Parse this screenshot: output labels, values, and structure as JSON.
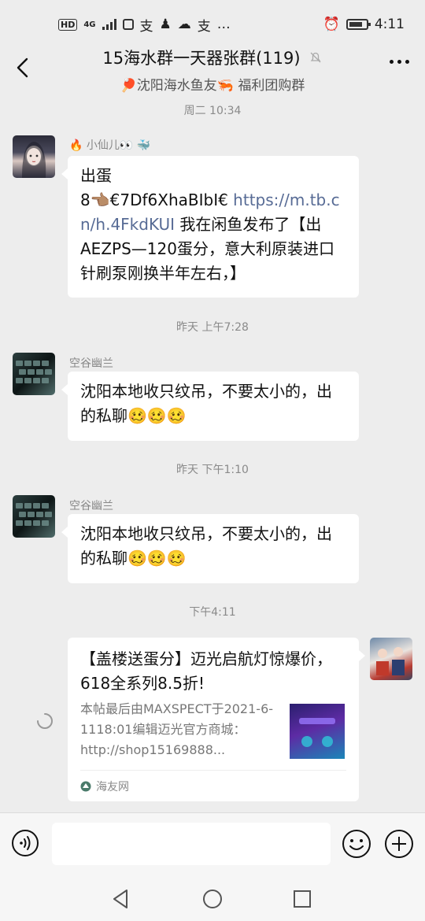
{
  "status_bar": {
    "hd": "HD",
    "net": "4G",
    "time": "4:11",
    "more": "…"
  },
  "header": {
    "title": "15海水群一天器张群(119)",
    "subtitle": "🏓沈阳海水鱼友🦐 福利团购群"
  },
  "timestamps": [
    "周二 10:34",
    "昨天 上午7:28",
    "昨天 下午1:10",
    "下午4:11"
  ],
  "messages": [
    {
      "sender": "🔥 小仙儿👀 🐳",
      "text_before": "出蛋\n8👈🏽€7Df6XhaBIbI€ ",
      "link": "https://m.tb.cn/h.4FkdKUI",
      "text_after": " 我在闲鱼发布了【出AEZPS—120蛋分，意大利原装进口针刷泵刚换半年左右，】"
    },
    {
      "sender": "空谷幽兰",
      "text": "沈阳本地收只纹吊，不要太小的，出的私聊🥴🥴🥴"
    },
    {
      "sender": "空谷幽兰",
      "text": "沈阳本地收只纹吊，不要太小的，出的私聊🥴🥴🥴"
    }
  ],
  "shared_card": {
    "title": "【盖楼送蛋分】迈光启航灯惊爆价，618全系列8.5折!",
    "description": "本帖最后由MAXSPECT于2021-6-1118:01编辑迈光官方商城：http://shop15169888...",
    "source": "海友网"
  },
  "input": {
    "placeholder": ""
  },
  "colors": {
    "background": "#ededed",
    "bubble": "#ffffff",
    "link": "#576b95",
    "muted": "#8a8a8a"
  }
}
